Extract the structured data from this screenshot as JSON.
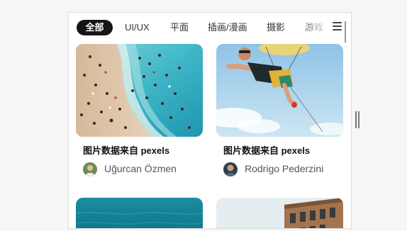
{
  "tabs": [
    {
      "label": "全部",
      "active": true
    },
    {
      "label": "UI/UX"
    },
    {
      "label": "平面"
    },
    {
      "label": "插画/漫画"
    },
    {
      "label": "摄影"
    },
    {
      "label": "游戏"
    }
  ],
  "cards": [
    {
      "title": "图片数据来自 pexels",
      "author": "Uğurcan Özmen"
    },
    {
      "title": "图片数据来自 pexels",
      "author": "Rodrigo Pederzini"
    }
  ],
  "icons": {
    "menu": "menu-icon"
  },
  "colors": {
    "active_tab_bg": "#151515",
    "panel_bg": "#ffffff",
    "page_bg": "#f6f6f6"
  }
}
